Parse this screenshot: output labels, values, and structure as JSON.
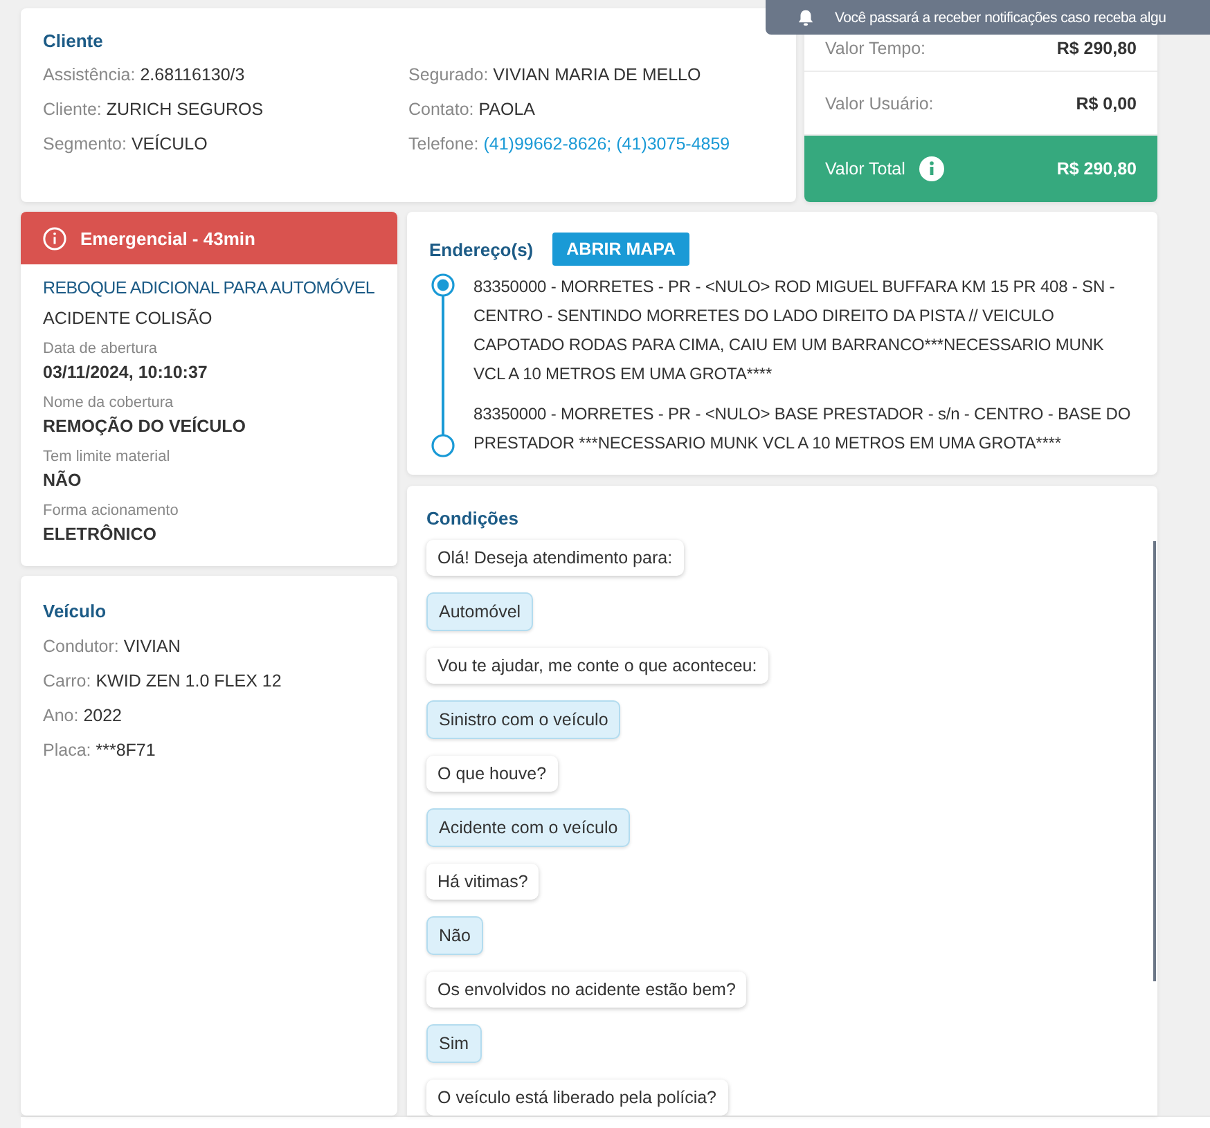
{
  "notification": {
    "text": "Você passará a receber notificações caso receba algu"
  },
  "client": {
    "title": "Cliente",
    "left_fields": [
      {
        "label": "Assistência:",
        "value": "2.68116130/3",
        "kind": "text"
      },
      {
        "label": "Cliente:",
        "value": "ZURICH SEGUROS",
        "kind": "text"
      },
      {
        "label": "Segmento:",
        "value": "VEÍCULO",
        "kind": "text"
      }
    ],
    "right_fields": [
      {
        "label": "Segurado:",
        "value": "VIVIAN MARIA DE MELLO",
        "kind": "text"
      },
      {
        "label": "Contato:",
        "value": "PAOLA",
        "kind": "text"
      },
      {
        "label": "Telefone:",
        "value": "(41)99662-8626; (41)3075-4859",
        "kind": "link"
      }
    ]
  },
  "values": {
    "rows": [
      {
        "label": "Valor Tempo:",
        "value": "R$ 290,80"
      },
      {
        "label": "Valor Usuário:",
        "value": "R$ 0,00"
      }
    ],
    "total": {
      "label": "Valor Total",
      "value": "R$ 290,80"
    }
  },
  "service": {
    "priority": "Emergencial - 43min",
    "title": "REBOQUE ADICIONAL PARA AUTOMÓVEL",
    "subtitle": "ACIDENTE COLISÃO",
    "fields": [
      {
        "label": "Data de abertura",
        "value": "03/11/2024, 10:10:37"
      },
      {
        "label": "Nome da cobertura",
        "value": "REMOÇÃO DO VEÍCULO"
      },
      {
        "label": "Tem limite material",
        "value": "NÃO"
      },
      {
        "label": "Forma acionamento",
        "value": "ELETRÔNICO"
      }
    ]
  },
  "vehicle": {
    "title": "Veículo",
    "fields": [
      {
        "label": "Condutor:",
        "value": "VIVIAN"
      },
      {
        "label": "Carro:",
        "value": "KWID ZEN 1.0 FLEX 12"
      },
      {
        "label": "Ano:",
        "value": "2022"
      },
      {
        "label": "Placa:",
        "value": "***8F71"
      }
    ]
  },
  "addresses": {
    "title": "Endereço(s)",
    "button": "ABRIR MAPA",
    "items": [
      {
        "kind": "origin",
        "text": "83350000 - MORRETES - PR - <NULO> ROD MIGUEL BUFFARA KM 15 PR 408 - SN - CENTRO - SENTINDO MORRETES DO LADO DIREITO DA PISTA // VEICULO CAPOTADO RODAS PARA CIMA, CAIU EM UM BARRANCO***NECESSARIO MUNK VCL A 10 METROS EM UMA GROTA****"
      },
      {
        "kind": "destination",
        "text": "83350000 - MORRETES - PR - <NULO> BASE PRESTADOR - s/n - CENTRO - BASE DO PRESTADOR ***NECESSARIO MUNK VCL A 10 METROS EM UMA GROTA****"
      }
    ]
  },
  "conditions": {
    "title": "Condições",
    "messages": [
      {
        "kind": "question",
        "text": "Olá! Deseja atendimento para:"
      },
      {
        "kind": "answer",
        "text": "Automóvel"
      },
      {
        "kind": "question",
        "text": "Vou te ajudar, me conte o que aconteceu:"
      },
      {
        "kind": "answer",
        "text": "Sinistro com o veículo"
      },
      {
        "kind": "question",
        "text": "O que houve?"
      },
      {
        "kind": "answer",
        "text": "Acidente com o veículo"
      },
      {
        "kind": "question",
        "text": "Há vitimas?"
      },
      {
        "kind": "answer",
        "text": "Não"
      },
      {
        "kind": "question",
        "text": "Os envolvidos no acidente estão bem?"
      },
      {
        "kind": "answer",
        "text": "Sim"
      },
      {
        "kind": "question",
        "text": "O veículo está liberado pela polícia?"
      }
    ]
  }
}
